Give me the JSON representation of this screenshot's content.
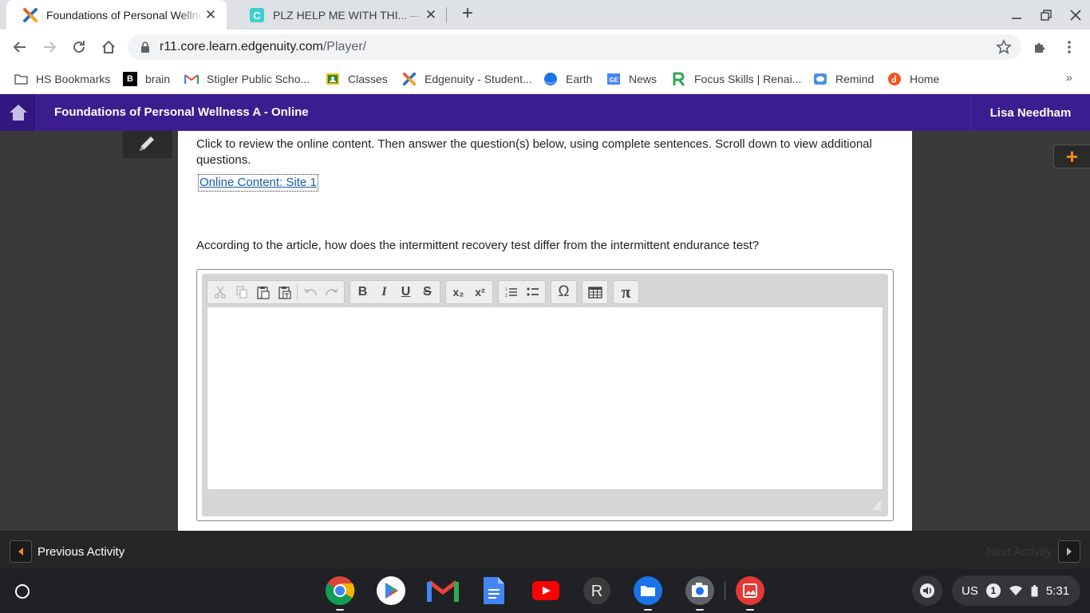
{
  "browser": {
    "tabs": [
      {
        "title": "Foundations of Personal Wellness A - Online",
        "active": true,
        "favicon": "edgenuity-x-icon"
      },
      {
        "title": "PLZ HELP ME WITH THI... — Quetzal",
        "active": false,
        "favicon": "quizlet-icon"
      }
    ],
    "url_host": "r11.core.learn.edgenuity.com",
    "url_path": "/Player/"
  },
  "bookmarks": [
    {
      "label": "HS Bookmarks",
      "icon": "folder-icon"
    },
    {
      "label": "brain",
      "icon": "brainly-icon"
    },
    {
      "label": "Stigler Public Scho...",
      "icon": "gmail-icon"
    },
    {
      "label": "Classes",
      "icon": "classroom-icon"
    },
    {
      "label": "Edgenuity - Student...",
      "icon": "edgenuity-x-icon"
    },
    {
      "label": "Earth",
      "icon": "earth-icon"
    },
    {
      "label": "News",
      "icon": "google-news-icon"
    },
    {
      "label": "Focus Skills | Renai...",
      "icon": "renaissance-icon"
    },
    {
      "label": "Remind",
      "icon": "remind-icon"
    },
    {
      "label": "Home",
      "icon": "home-orange-icon"
    }
  ],
  "bookmarks_more": "»",
  "header": {
    "course_title": "Foundations of Personal Wellness A - Online",
    "user_name": "Lisa Needham"
  },
  "content": {
    "instructions": "Click to review the online content. Then answer the question(s) below, using complete sentences. Scroll down to view additional questions.",
    "site_link": "Online Content: Site 1",
    "question": "According to the article, how does the intermittent recovery test differ from the intermittent endurance test?",
    "answer_value": ""
  },
  "editor_toolbar": {
    "groups": [
      [
        "cut-icon",
        "copy-icon",
        "paste-icon",
        "paste-text-icon",
        "|",
        "undo-icon",
        "redo-icon"
      ],
      [
        "bold-icon",
        "italic-icon",
        "underline-icon",
        "strikethrough-icon"
      ],
      [
        "subscript-icon",
        "superscript-icon"
      ],
      [
        "numbered-list-icon",
        "bulleted-list-icon"
      ],
      [
        "special-char-icon"
      ],
      [
        "table-icon"
      ],
      [
        "math-pi-icon"
      ]
    ],
    "glyphs": {
      "bold": "B",
      "italic": "I",
      "underline": "U",
      "strike": "S",
      "subscript": "x₂",
      "superscript": "x²",
      "omega": "Ω",
      "pi": "π"
    }
  },
  "activity_bar": {
    "previous_label": "Previous Activity",
    "next_label": "Next Activity"
  },
  "shelf": {
    "apps": [
      "chrome-icon",
      "play-store-icon",
      "gmail-icon",
      "docs-icon",
      "youtube-icon",
      "r-app-icon",
      "files-icon",
      "camera-icon",
      "gallery-icon"
    ],
    "r_app_letter": "R",
    "ime": "US",
    "notification_count": "1",
    "time": "5:31"
  },
  "colors": {
    "edgenuity_purple": "#3b1d8f",
    "accent_orange": "#f5861f",
    "link_blue": "#1a5fa8"
  }
}
